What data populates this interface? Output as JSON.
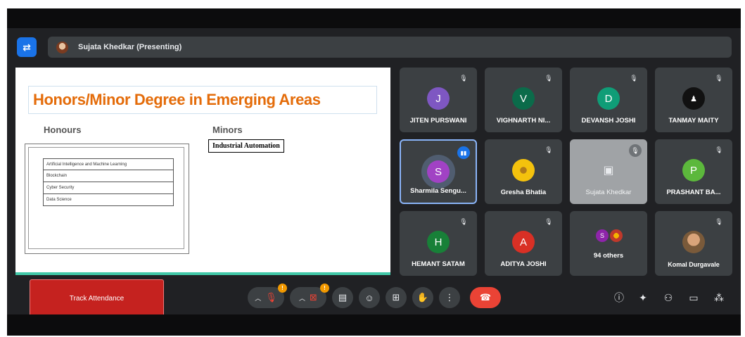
{
  "presenter": {
    "name": "Sujata Khedkar (Presenting)"
  },
  "slide": {
    "title": "Honors/Minor Degree in Emerging Areas",
    "honours_heading": "Honours",
    "minors_heading": "Minors",
    "honours_items": [
      "Artificial Intelligence and Machine Learning",
      "Blockchain",
      "Cyber Security",
      "Data Science"
    ],
    "minors_items": [
      "Industrial Automation"
    ]
  },
  "participants": [
    {
      "name": "JITEN PURSWANI",
      "initial": "J",
      "color": "#7e57c2"
    },
    {
      "name": "VIGHNARTH NI...",
      "initial": "V",
      "color": "#0b6b4a"
    },
    {
      "name": "DEVANSH JOSHI",
      "initial": "D",
      "color": "#0f9d77"
    },
    {
      "name": "TANMAY MAITY",
      "initial": "",
      "color": "#111111"
    },
    {
      "name": "Sharmila Sengu...",
      "initial": "S",
      "color": "#a142c4"
    },
    {
      "name": "Gresha Bhatia",
      "initial": "",
      "color": "#f4c20d"
    },
    {
      "name": "Sujata Khedkar",
      "initial": "",
      "color": "#a0a3a6"
    },
    {
      "name": "PRASHANT BA...",
      "initial": "P",
      "color": "#5cb83c"
    },
    {
      "name": "HEMANT SATAM",
      "initial": "H",
      "color": "#188038"
    },
    {
      "name": "ADITYA JOSHI",
      "initial": "A",
      "color": "#d93025"
    },
    {
      "name": "94 others",
      "initial": "S",
      "color": "#8e24aa"
    },
    {
      "name": "Komal Durgavale",
      "initial": "",
      "color": "#b8865a"
    }
  ],
  "controls": {
    "track_attendance": "Track Attendance",
    "mic_badge": "!",
    "camera_badge": "!"
  },
  "colors": {
    "accent": "#1a73e8",
    "end_call": "#ea4335",
    "title_orange": "#e46c0a"
  }
}
